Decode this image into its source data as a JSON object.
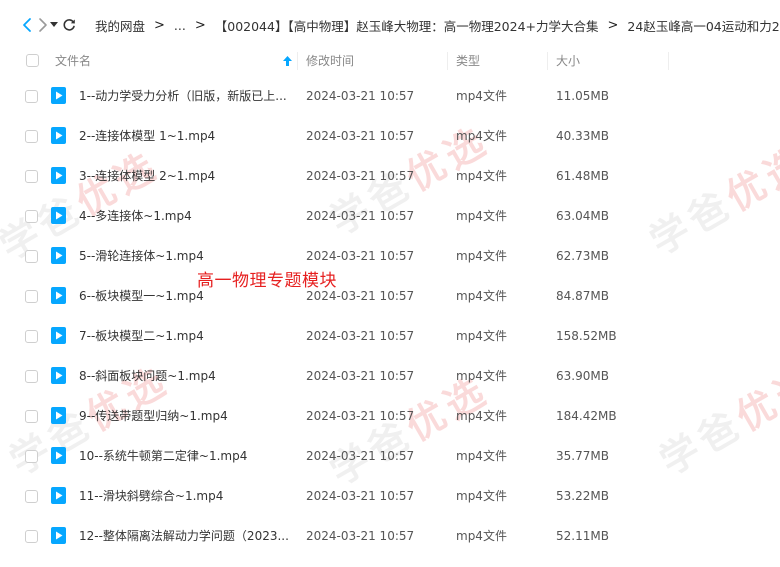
{
  "nav": {
    "back_icon": "chevron-left-icon",
    "forward_icon": "chevron-right-icon",
    "history_icon": "caret-down-icon",
    "refresh_icon": "refresh-icon"
  },
  "breadcrumb": {
    "items": [
      "我的网盘",
      "...",
      "【002044】【高中物理】赵玉峰大物理：高一物理2024+力学大合集",
      "24赵玉峰高一04运动和力2"
    ],
    "separator": ">"
  },
  "columns": {
    "name": "文件名",
    "modified": "修改时间",
    "type": "类型",
    "size": "大小",
    "sort_icon": "sort-ascending-arrow-icon"
  },
  "files": [
    {
      "name": "1--动力学受力分析（旧版，新版已上...",
      "modified": "2024-03-21 10:57",
      "type": "mp4文件",
      "size": "11.05MB"
    },
    {
      "name": "2--连接体模型 1~1.mp4",
      "modified": "2024-03-21 10:57",
      "type": "mp4文件",
      "size": "40.33MB"
    },
    {
      "name": "3--连接体模型 2~1.mp4",
      "modified": "2024-03-21 10:57",
      "type": "mp4文件",
      "size": "61.48MB"
    },
    {
      "name": "4--多连接体~1.mp4",
      "modified": "2024-03-21 10:57",
      "type": "mp4文件",
      "size": "63.04MB"
    },
    {
      "name": "5--滑轮连接体~1.mp4",
      "modified": "2024-03-21 10:57",
      "type": "mp4文件",
      "size": "62.73MB"
    },
    {
      "name": "6--板块模型一~1.mp4",
      "modified": "2024-03-21 10:57",
      "type": "mp4文件",
      "size": "84.87MB"
    },
    {
      "name": "7--板块模型二~1.mp4",
      "modified": "2024-03-21 10:57",
      "type": "mp4文件",
      "size": "158.52MB"
    },
    {
      "name": "8--斜面板块问题~1.mp4",
      "modified": "2024-03-21 10:57",
      "type": "mp4文件",
      "size": "63.90MB"
    },
    {
      "name": "9--传送带题型归纳~1.mp4",
      "modified": "2024-03-21 10:57",
      "type": "mp4文件",
      "size": "184.42MB"
    },
    {
      "name": "10--系统牛顿第二定律~1.mp4",
      "modified": "2024-03-21 10:57",
      "type": "mp4文件",
      "size": "35.77MB"
    },
    {
      "name": "11--滑块斜劈综合~1.mp4",
      "modified": "2024-03-21 10:57",
      "type": "mp4文件",
      "size": "53.22MB"
    },
    {
      "name": "12--整体隔离法解动力学问题（2023...",
      "modified": "2024-03-21 10:57",
      "type": "mp4文件",
      "size": "52.11MB"
    }
  ],
  "file_icon": "video-file-icon",
  "overlay_label": "高一物理专题模块",
  "watermark": {
    "text_a": "学爸",
    "text_b": "优选"
  },
  "colors": {
    "accent": "#06a7ff",
    "overlay_text": "#e62020"
  }
}
